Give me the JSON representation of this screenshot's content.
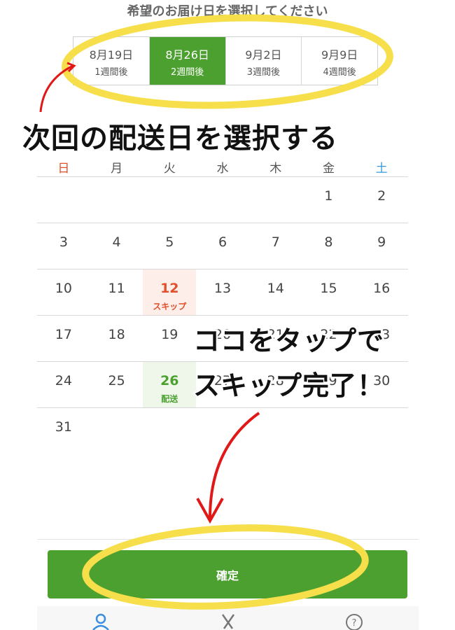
{
  "heading": "希望のお届け日を選択してください",
  "date_tabs": [
    {
      "date": "8月19日",
      "weeks": "1週間後",
      "selected": false
    },
    {
      "date": "8月26日",
      "weeks": "2週間後",
      "selected": true
    },
    {
      "date": "9月2日",
      "weeks": "3週間後",
      "selected": false
    },
    {
      "date": "9月9日",
      "weeks": "4週間後",
      "selected": false
    }
  ],
  "annotations": {
    "select_next": "次回の配送日を選択する",
    "tap_here_line1": "ココをタップで",
    "tap_here_line2": "スキップ完了！"
  },
  "weekdays": [
    "日",
    "月",
    "火",
    "水",
    "木",
    "金",
    "土"
  ],
  "calendar": {
    "weeks": [
      [
        "",
        "",
        "",
        "",
        "",
        "1",
        "2"
      ],
      [
        "3",
        "4",
        "5",
        "6",
        "7",
        "8",
        "9"
      ],
      [
        "10",
        "11",
        "12",
        "13",
        "14",
        "15",
        "16"
      ],
      [
        "17",
        "18",
        "19",
        "20",
        "21",
        "22",
        "23"
      ],
      [
        "24",
        "25",
        "26",
        "27",
        "28",
        "29",
        "30"
      ],
      [
        "31",
        "",
        "",
        "",
        "",
        "",
        ""
      ]
    ],
    "skip_label": "スキップ",
    "delivery_label": "配送"
  },
  "confirm_button": "確定",
  "colors": {
    "accent": "#4ca02f",
    "skip": "#e0502a",
    "highlight": "#f6df4a",
    "arrow": "#e01818"
  },
  "nav_icons": [
    "user-icon",
    "fork-knife-icon",
    "help-icon"
  ]
}
